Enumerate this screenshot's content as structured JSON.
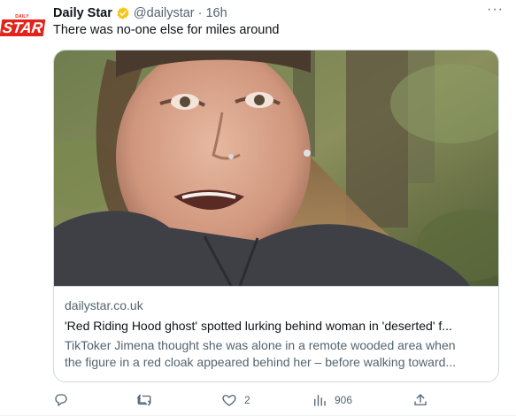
{
  "tweet": {
    "name": "Daily Star",
    "handle": "@dailystar",
    "dot": "·",
    "time": "16h",
    "more": "···",
    "text": "There was no-one else for miles around",
    "avatar": {
      "small": "DAILY",
      "big": "STAR"
    }
  },
  "card": {
    "domain": "dailystar.co.uk",
    "title": "'Red Riding Hood ghost' spotted lurking behind woman in 'deserted' f...",
    "desc_line1": "TikToker Jimena thought she was alone in a remote wooded area when",
    "desc_line2": "the figure in a red cloak appeared behind her – before walking toward..."
  },
  "actions": {
    "reply": {
      "icon": "reply-icon",
      "count": ""
    },
    "retweet": {
      "icon": "retweet-icon",
      "count": ""
    },
    "like": {
      "icon": "heart-icon",
      "count": "2"
    },
    "views": {
      "icon": "views-icon",
      "count": "906"
    },
    "share": {
      "icon": "share-icon",
      "count": ""
    }
  },
  "colors": {
    "brand": "#e2231a",
    "verified": "#f5c518",
    "muted": "#536471",
    "text": "#0f1419"
  }
}
